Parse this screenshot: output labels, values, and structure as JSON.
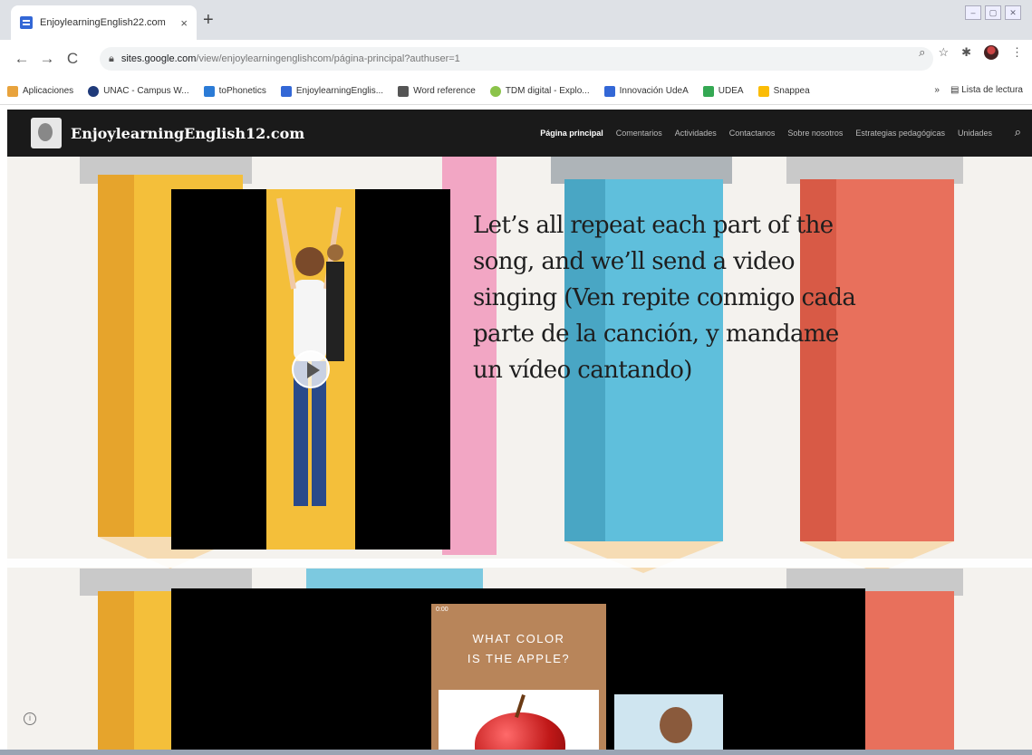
{
  "browser": {
    "tab_title": "EnjoylearningEnglish22.com",
    "tab_close": "×",
    "new_tab": "+",
    "url_host": "sites.google.com",
    "url_path": "/view/enjoylearningenglishcom/página-principal?authuser=1",
    "nav": {
      "back": "←",
      "forward": "→",
      "reload": "C"
    },
    "bookmarks": [
      {
        "label": "Aplicaciones",
        "color": "#e8a33d"
      },
      {
        "label": "UNAC - Campus W...",
        "color": "#1f3a7a"
      },
      {
        "label": "toPhonetics",
        "color": "#2b7bd6"
      },
      {
        "label": "EnjoylearningEnglis...",
        "color": "#3367d6"
      },
      {
        "label": "Word reference",
        "color": "#555555"
      },
      {
        "label": "TDM digital - Explo...",
        "color": "#8bc34a"
      },
      {
        "label": "Innovación UdeA",
        "color": "#3367d6"
      },
      {
        "label": "UDEA",
        "color": "#34a853"
      },
      {
        "label": "Snappea",
        "color": "#fbbc05"
      }
    ],
    "reading_list": "Lista de lectura",
    "bookmarks_more": "»"
  },
  "site": {
    "title": "EnjoylearningEnglish12.com",
    "nav": [
      "Página principal",
      "Comentarios",
      "Actividades",
      "Contactanos",
      "Sobre nosotros",
      "Estrategias pedagógicas",
      "Unidades"
    ],
    "active_nav": "Página principal"
  },
  "content": {
    "song_text": "Let’s all repeat each part of the song, and we’ll send a video singing (Ven repite conmigo cada parte de la canción, y mandame un vídeo cantando)",
    "video2": {
      "time": "0:00",
      "question": "WHAT COLOR\nIS THE APPLE?"
    }
  },
  "colors": {
    "header_bg": "#1a1a1a",
    "pencil_yellow": "#f4bf3a",
    "pencil_pink": "#f2a6c4",
    "pencil_blue": "#5fbfdc",
    "pencil_red": "#e8705c"
  }
}
